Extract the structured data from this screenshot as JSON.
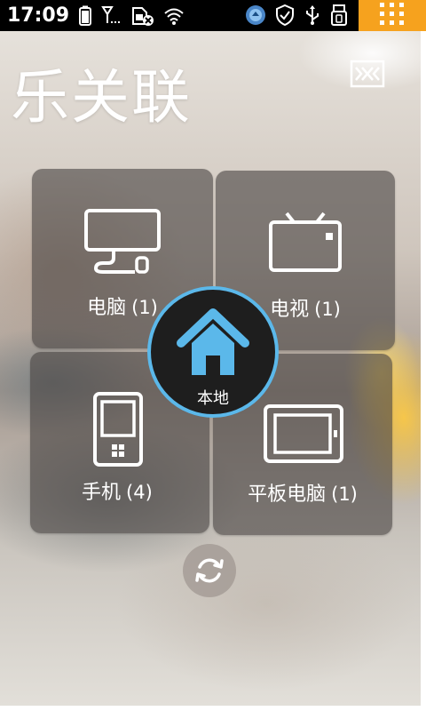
{
  "status_bar": {
    "time": "17:09",
    "icons_left": [
      "battery-icon",
      "signal-icon",
      "sim-blocked-icon",
      "wifi-icon"
    ],
    "icons_right": [
      "app-badge-icon",
      "shield-icon",
      "usb-icon",
      "usb-storage-icon",
      "app-grid-icon"
    ],
    "grid_color": "#f6a21e"
  },
  "header": {
    "title": "乐关联",
    "switch_icon": "switch-device-icon"
  },
  "devices": [
    {
      "name": "电脑",
      "count": "(1)",
      "icon": "computer-icon"
    },
    {
      "name": "电视",
      "count": "(1)",
      "icon": "tv-icon"
    },
    {
      "name": "手机",
      "count": "(4)",
      "icon": "phone-icon"
    },
    {
      "name": "平板电脑",
      "count": "(1)",
      "icon": "tablet-icon"
    }
  ],
  "center": {
    "label": "本地",
    "icon": "home-icon",
    "accent_color": "#5bb8ea"
  },
  "refresh": {
    "icon": "refresh-icon"
  }
}
